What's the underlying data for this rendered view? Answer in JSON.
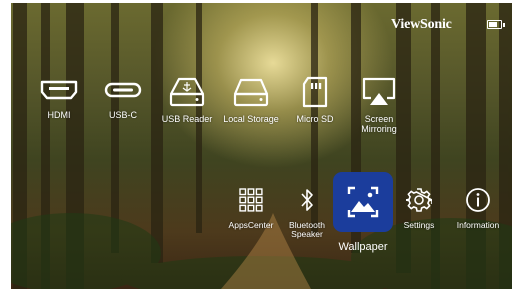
{
  "header": {
    "brand": "ViewSonic",
    "battery_level": 0.7
  },
  "sources": [
    {
      "label": "HDMI",
      "icon": "hdmi-port-icon"
    },
    {
      "label": "USB-C",
      "icon": "usb-c-port-icon"
    },
    {
      "label": "USB Reader",
      "icon": "usb-drive-icon"
    },
    {
      "label": "Local Storage",
      "icon": "hard-drive-icon"
    },
    {
      "label": "Micro SD",
      "icon": "sd-card-icon"
    },
    {
      "label": "Screen\nMirroring",
      "icon": "screen-mirroring-icon"
    }
  ],
  "apps": [
    {
      "label": "AppsCenter",
      "icon": "apps-grid-icon"
    },
    {
      "label": "Bluetooth\nSpeaker",
      "icon": "bluetooth-icon"
    },
    {
      "label": "Wallpaper",
      "icon": "wallpaper-icon",
      "selected": true
    },
    {
      "label": "Settings",
      "icon": "gear-icon"
    },
    {
      "label": "Information",
      "icon": "info-icon"
    }
  ],
  "colors": {
    "selected_tile": "#1b3d9c",
    "text": "#ffffff"
  }
}
